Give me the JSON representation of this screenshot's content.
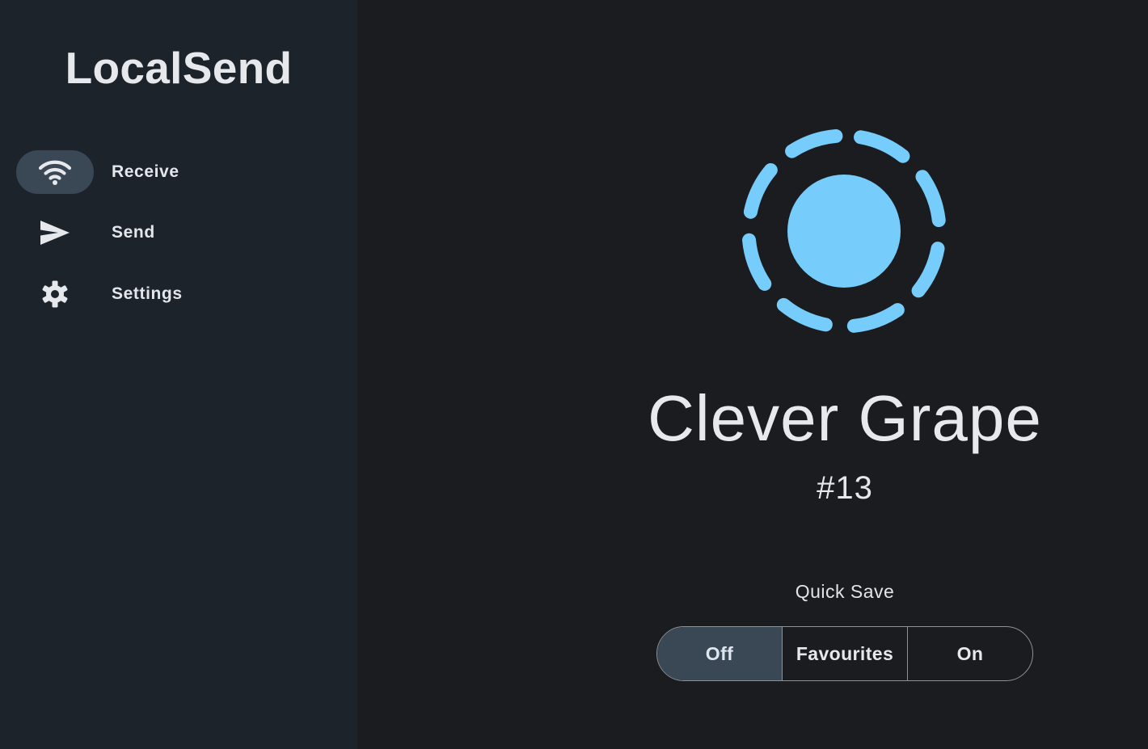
{
  "app": {
    "title": "LocalSend"
  },
  "sidebar": {
    "items": [
      {
        "label": "Receive",
        "icon": "wifi-icon",
        "active": true
      },
      {
        "label": "Send",
        "icon": "send-icon",
        "active": false
      },
      {
        "label": "Settings",
        "icon": "gear-icon",
        "active": false
      }
    ]
  },
  "device": {
    "name": "Clever Grape",
    "number": "#13"
  },
  "quick_save": {
    "label": "Quick Save",
    "options": [
      "Off",
      "Favourites",
      "On"
    ],
    "selected": "Off"
  },
  "colors": {
    "accent": "#76ccfb",
    "sidebar_bg": "#1d232b",
    "main_bg": "#1b1c1f",
    "selected_bg": "#3a4755"
  }
}
